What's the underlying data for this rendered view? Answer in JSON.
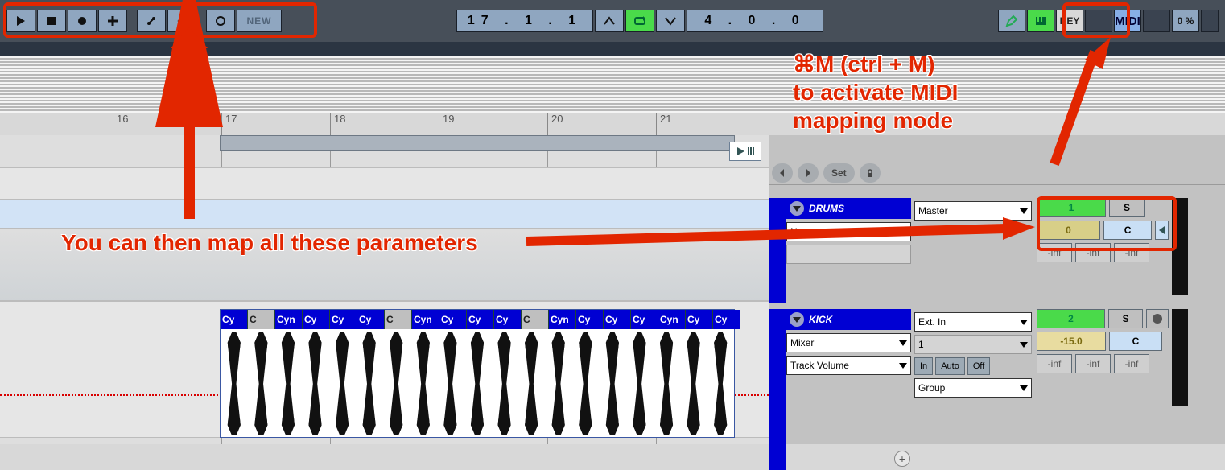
{
  "toolbar": {
    "new_label": "NEW",
    "position": "17 . 1 . 1",
    "tempo": "4 . 0 . 0",
    "key_label": "KEY",
    "midi_label": "MIDI",
    "pct_label": "0 %"
  },
  "ruler": {
    "marks": [
      "16",
      "17",
      "18",
      "19",
      "20",
      "21"
    ]
  },
  "clip_labels": [
    "Cy",
    "C",
    "Cyn",
    "Cy",
    "Cy",
    "Cy",
    "C",
    "Cyn",
    "Cy",
    "Cy",
    "Cy",
    "C",
    "Cyn",
    "Cy",
    "Cy",
    "Cy",
    "Cyn",
    "Cy",
    "Cy"
  ],
  "nav": {
    "set_label": "Set"
  },
  "tracks": {
    "drums": {
      "name": "DRUMS",
      "io_routing": "Master",
      "io_none": "None",
      "mix_num": "1",
      "mix_s": "S",
      "mix_delay": "0",
      "mix_pan": "C",
      "inf": "-inf"
    },
    "kick": {
      "name": "KICK",
      "io_source": "Ext. In",
      "io_mixer": "Mixer",
      "io_ch": "1",
      "io_volume": "Track Volume",
      "io_in": "In",
      "io_auto": "Auto",
      "io_off": "Off",
      "io_group": "Group",
      "mix_num": "2",
      "mix_s": "S",
      "mix_gain": "-15.0",
      "mix_pan": "C",
      "inf": "-inf"
    }
  },
  "annotations": {
    "right": "⌘M (ctrl + M)\nto activate MIDI\nmapping mode",
    "left": "You can then map all these parameters"
  }
}
